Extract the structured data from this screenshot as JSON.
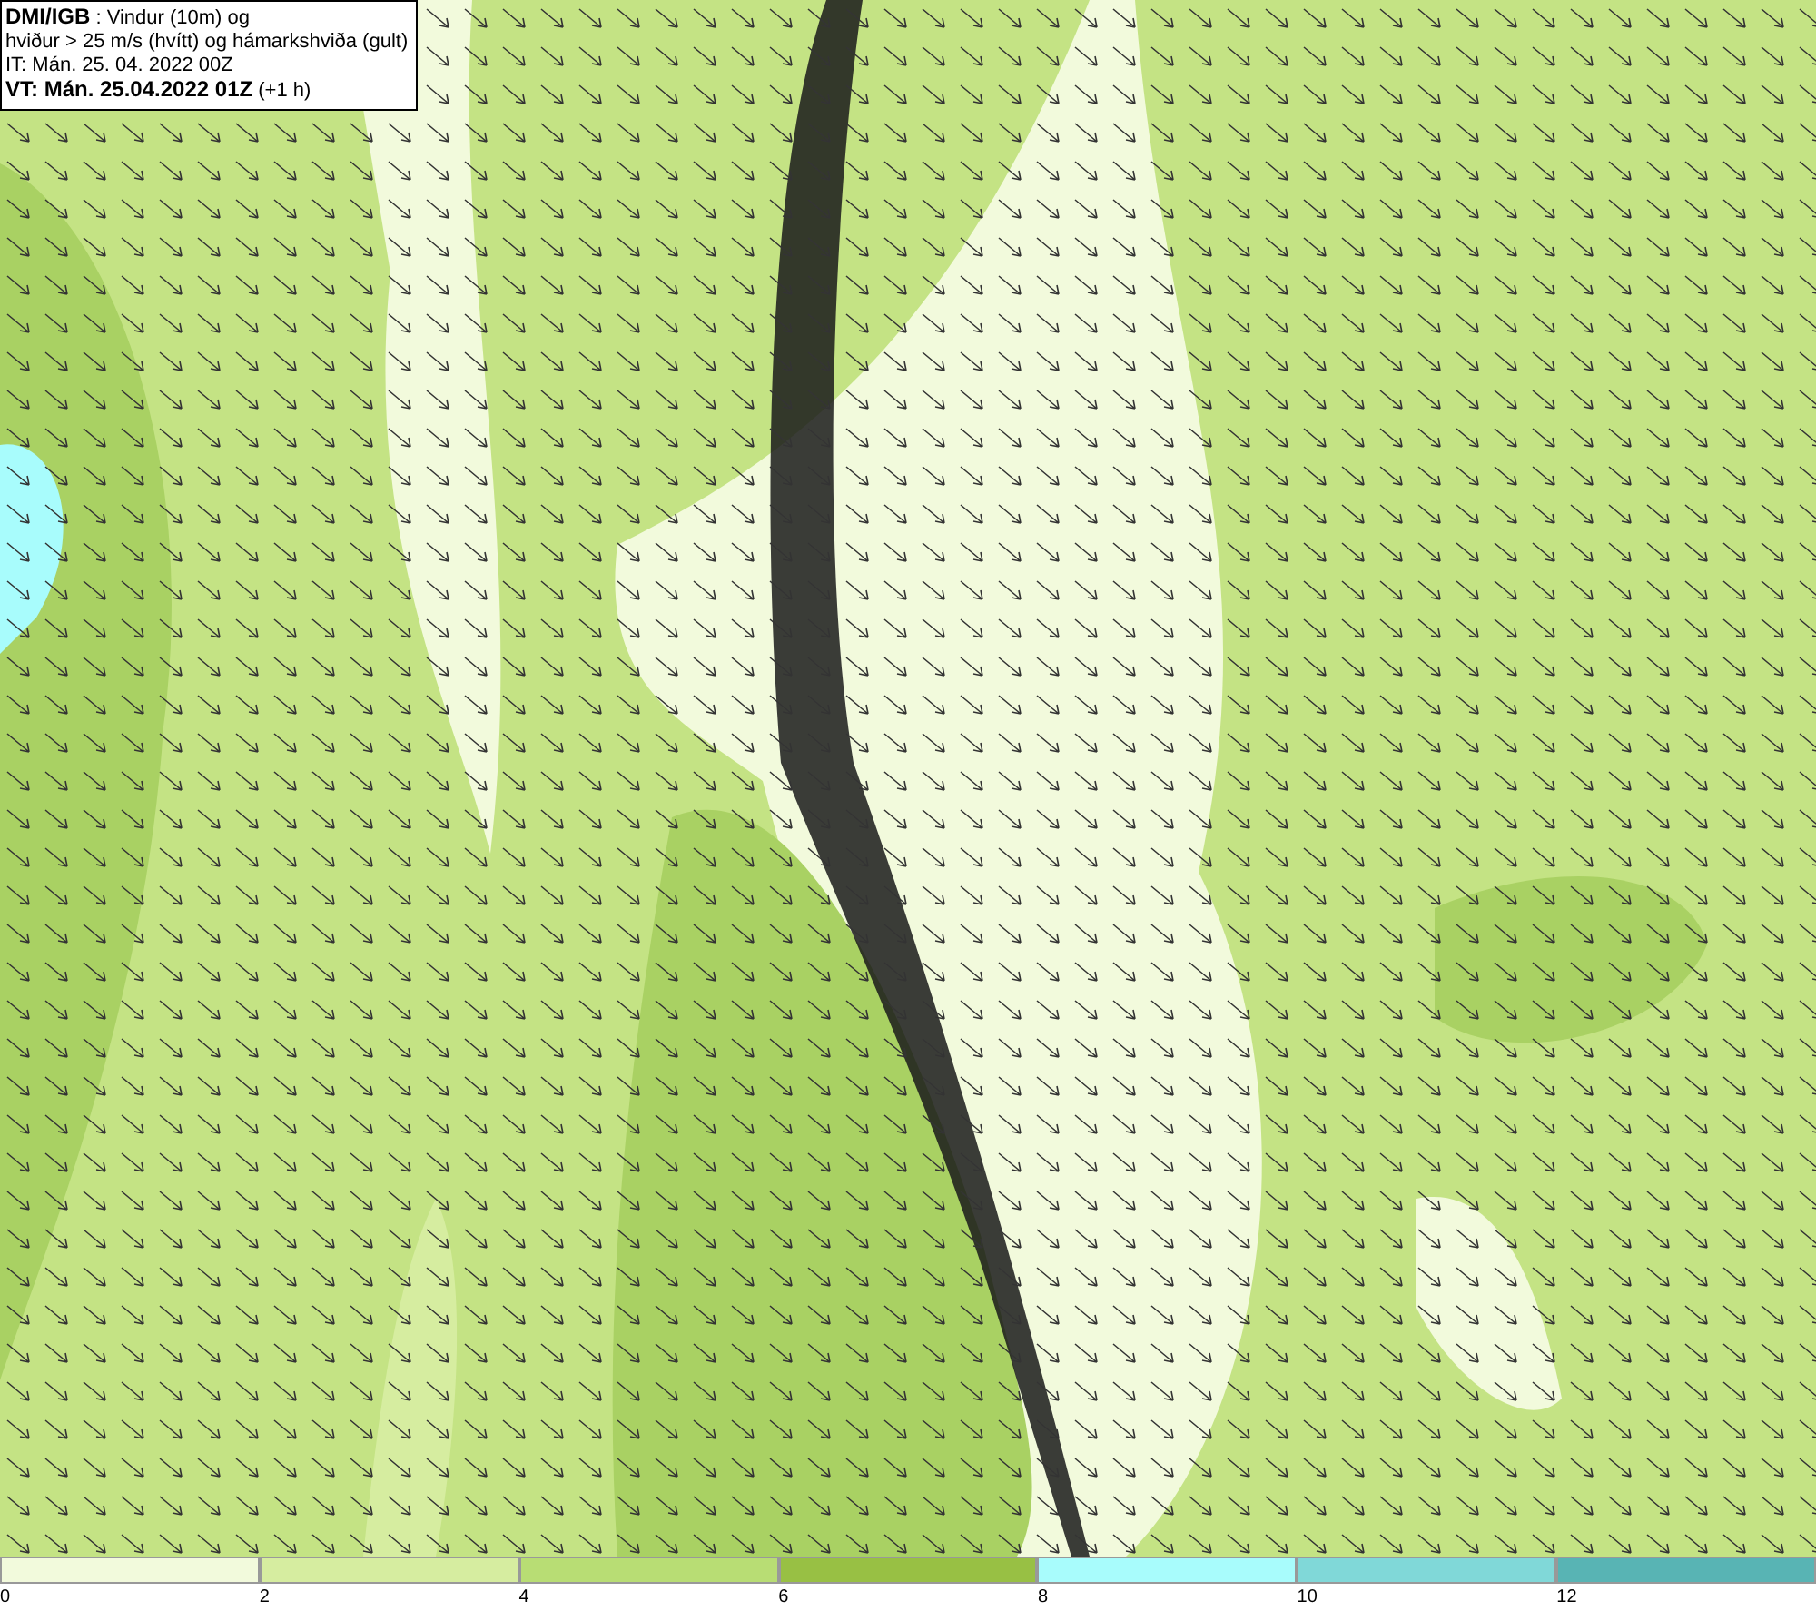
{
  "info_box": {
    "lines": [
      "**DMI/IGB** : Vindur (10m) og",
      "hviður > 25 m/s (hvítt) og hámarkshviða (gult)",
      "IT: Mán. 25. 04. 2022 00Z",
      "**VT: Mán. 25.04.2022 01Z** (+1 h)"
    ]
  },
  "legend": [
    {
      "label": "0",
      "color": "#f2fadc"
    },
    {
      "label": "2",
      "color": "#d6eda0"
    },
    {
      "label": "4",
      "color": "#b8dd74"
    },
    {
      "label": "6",
      "color": "#98c044"
    },
    {
      "label": "8",
      "color": "#a8fcfc"
    },
    {
      "label": "10",
      "color": "#80d8d8"
    },
    {
      "label": "12",
      "color": "#58b4b4"
    }
  ]
}
